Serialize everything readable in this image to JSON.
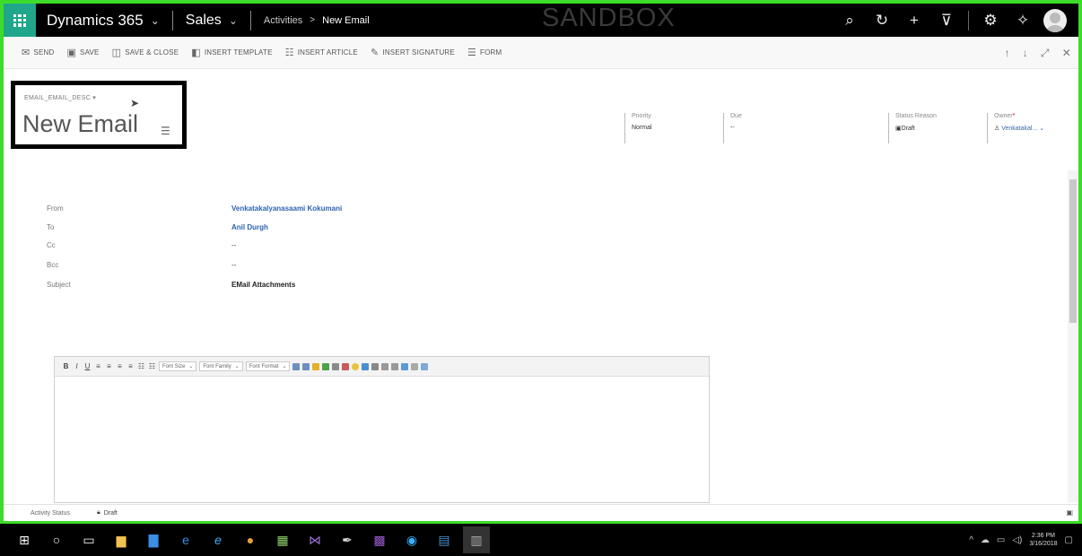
{
  "topnav": {
    "app_title": "Dynamics 365",
    "module": "Sales",
    "breadcrumb_1": "Activities",
    "breadcrumb_2": "New Email",
    "environment": "SANDBOX"
  },
  "commands": {
    "send": "SEND",
    "save": "SAVE",
    "save_close": "SAVE & CLOSE",
    "insert_template": "INSERT TEMPLATE",
    "insert_article": "INSERT ARTICLE",
    "insert_signature": "INSERT SIGNATURE",
    "form": "FORM"
  },
  "header": {
    "entity_selector": "EMAIL_EMAIL_DESC",
    "title": "New Email",
    "priority_label": "Priority",
    "priority_value": "Normal",
    "due_label": "Due",
    "due_value": "--",
    "status_reason_label": "Status Reason",
    "status_reason_value": "Draft",
    "owner_label": "Owner",
    "owner_value": "Venkatakal..."
  },
  "form": {
    "from_label": "From",
    "from_value": "Venkatakalyanasaami Kokumani",
    "to_label": "To",
    "to_value": "Anil Durgh",
    "cc_label": "Cc",
    "cc_value": "--",
    "bcc_label": "Bcc",
    "bcc_value": "--",
    "subject_label": "Subject",
    "subject_value": "EMail Attachments"
  },
  "editor": {
    "font_size": "Font Size",
    "font_family": "Font Family",
    "font_format": "Font Format"
  },
  "footer": {
    "activity_status_label": "Activity Status",
    "activity_status_value": "Draft"
  },
  "taskbar": {
    "time": "2:36 PM",
    "date": "3/16/2018"
  },
  "colors": {
    "frame_green": "#3ddc2a",
    "waffle_teal": "#1fa68b",
    "link_blue": "#2b63b0"
  }
}
